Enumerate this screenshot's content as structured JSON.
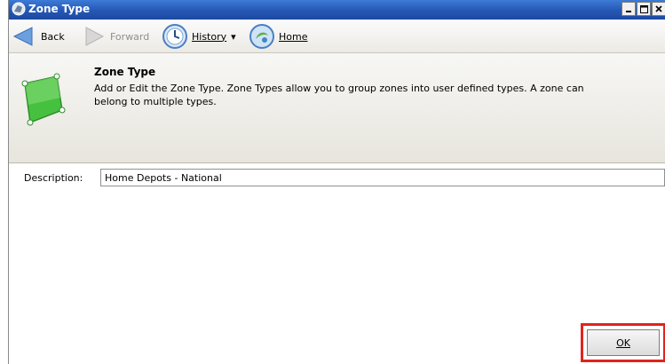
{
  "window": {
    "title": "Zone Type"
  },
  "nav": {
    "back": "Back",
    "forward": "Forward",
    "history": "History",
    "history_arrow": "▾",
    "home": "Home"
  },
  "header": {
    "title": "Zone Type",
    "description": "Add or Edit the Zone Type. Zone Types allow you to group zones into user defined types. A zone can belong to multiple types."
  },
  "form": {
    "description_label": "Description:",
    "description_value": "Home Depots - National"
  },
  "buttons": {
    "ok": "OK"
  },
  "colors": {
    "highlight": "#e0241f",
    "titlebar": "#2457b4",
    "icon_green": "#3fbf3a"
  }
}
